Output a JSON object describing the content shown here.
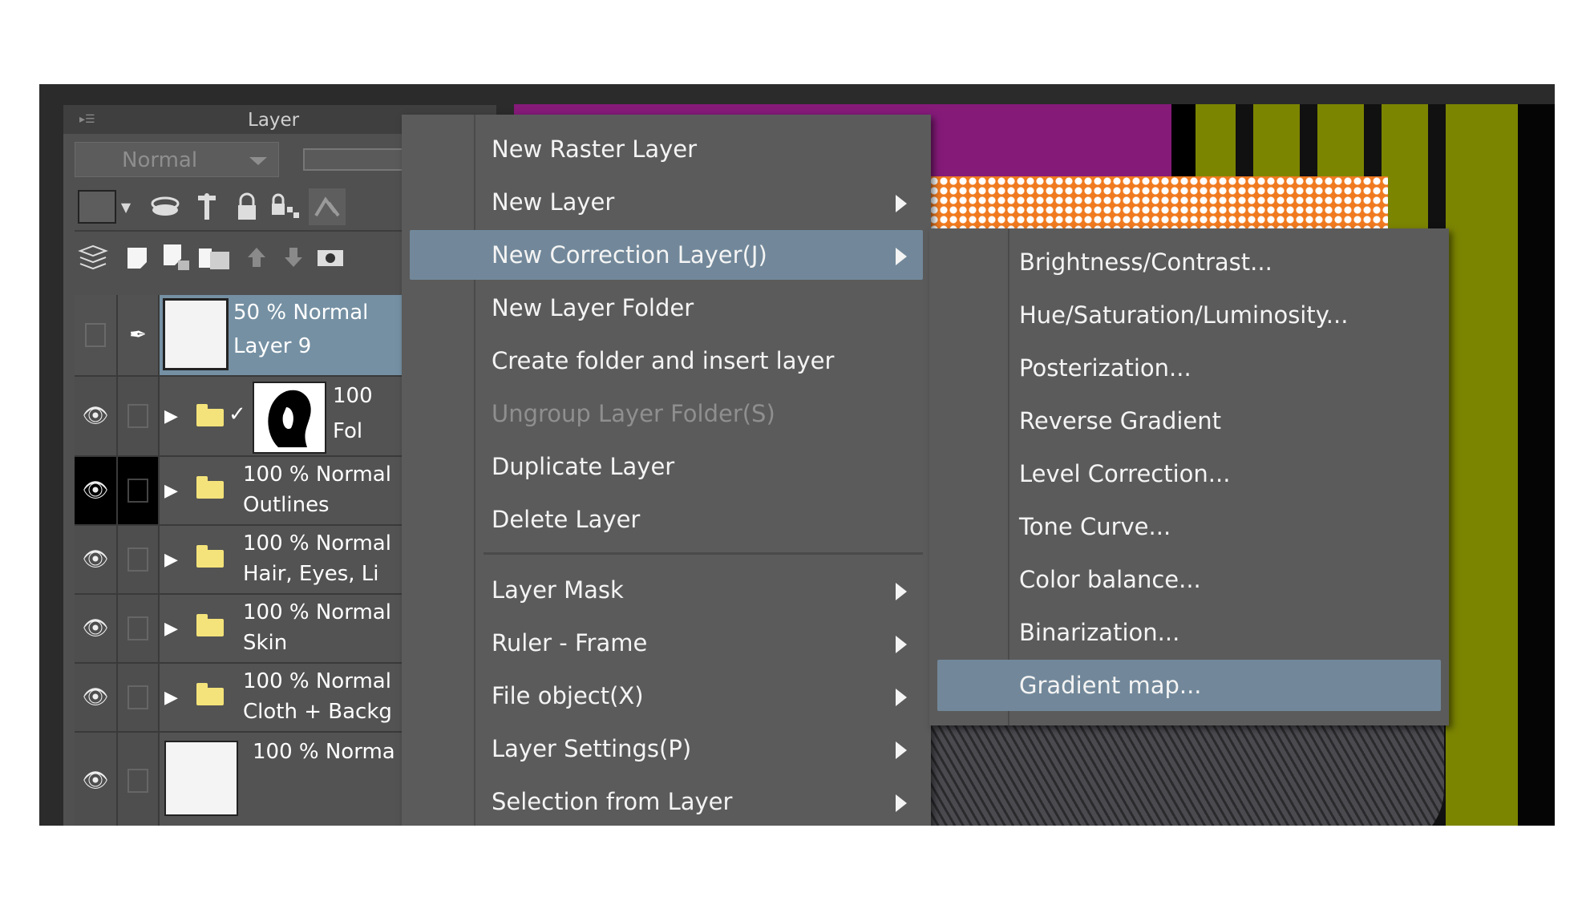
{
  "panel": {
    "title": "Layer",
    "blend_mode": "Normal"
  },
  "layers": [
    {
      "line1": "50 % Normal",
      "line2": "Layer 9"
    },
    {
      "line1": "100",
      "line2": "Fol"
    },
    {
      "line1": "100 % Normal",
      "line2": "Outlines"
    },
    {
      "line1": "100 % Normal",
      "line2": "Hair, Eyes, Li"
    },
    {
      "line1": "100 % Normal",
      "line2": "Skin"
    },
    {
      "line1": "100 % Normal",
      "line2": "Cloth + Backg"
    },
    {
      "line1": "100 % Norma",
      "line2": ""
    }
  ],
  "menu": {
    "items": [
      {
        "label": "New Raster Layer"
      },
      {
        "label": "New Layer"
      },
      {
        "label": "New Correction Layer(J)"
      },
      {
        "label": "New Layer Folder"
      },
      {
        "label": "Create folder and insert layer"
      },
      {
        "label": "Ungroup Layer Folder(S)"
      },
      {
        "label": "Duplicate Layer"
      },
      {
        "label": "Delete Layer"
      },
      {
        "label": "Layer Mask"
      },
      {
        "label": "Ruler - Frame"
      },
      {
        "label": "File object(X)"
      },
      {
        "label": "Layer Settings(P)"
      },
      {
        "label": "Selection from Layer"
      }
    ]
  },
  "submenu": {
    "items": [
      {
        "label": "Brightness/Contrast..."
      },
      {
        "label": "Hue/Saturation/Luminosity..."
      },
      {
        "label": "Posterization..."
      },
      {
        "label": "Reverse Gradient"
      },
      {
        "label": "Level Correction..."
      },
      {
        "label": "Tone Curve..."
      },
      {
        "label": "Color balance..."
      },
      {
        "label": "Binarization..."
      },
      {
        "label": "Gradient map..."
      }
    ]
  },
  "colors": {
    "highlight": "#72889a",
    "menu_bg": "#5b5b5b",
    "panel_bg": "#505050"
  }
}
